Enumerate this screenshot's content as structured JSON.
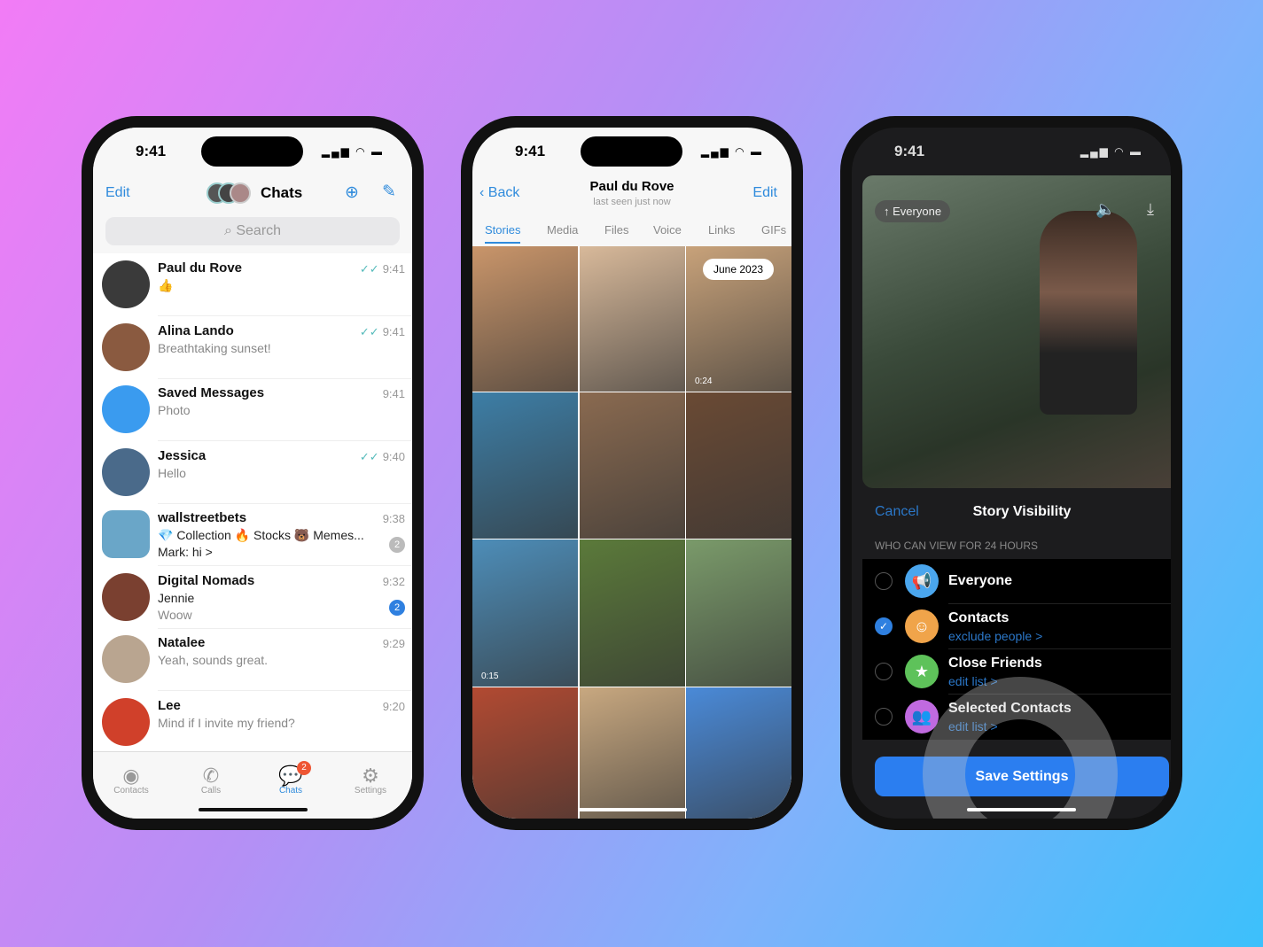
{
  "status_time": "9:41",
  "chats_screen": {
    "edit": "Edit",
    "title": "Chats",
    "search_placeholder": "Search",
    "chats": [
      {
        "name": "Paul du Rove",
        "preview": "👍",
        "time": "9:41",
        "read": true,
        "avatar_color": "#3a3a3a"
      },
      {
        "name": "Alina Lando",
        "preview": "Breathtaking sunset!",
        "time": "9:41",
        "read": true,
        "avatar_color": "#8a5a40"
      },
      {
        "name": "Saved Messages",
        "preview": "Photo",
        "time": "9:41",
        "read": false,
        "avatar_color": "#3a9bef"
      },
      {
        "name": "Jessica",
        "preview": "Hello",
        "time": "9:40",
        "read": true,
        "avatar_color": "#4a6a8a"
      },
      {
        "name": "wallstreetbets",
        "preview": "💎 Collection 🔥 Stocks 🐻 Memes...",
        "preview2": "Mark: hi >",
        "time": "9:38",
        "badge": "2",
        "avatar_color": "#6aa6c8"
      },
      {
        "name": "Digital Nomads",
        "preview": "Jennie",
        "preview2": "Woow",
        "time": "9:32",
        "badge": "2",
        "avatar_color": "#7a4030"
      },
      {
        "name": "Natalee",
        "preview": "Yeah, sounds great.",
        "time": "9:29",
        "avatar_color": "#b9a590"
      },
      {
        "name": "Lee",
        "preview": "Mind if I invite my friend?",
        "time": "9:20",
        "avatar_color": "#d0402a"
      }
    ],
    "tabs": [
      {
        "label": "Contacts",
        "icon": "person-circle"
      },
      {
        "label": "Calls",
        "icon": "phone"
      },
      {
        "label": "Chats",
        "icon": "chat-bubbles",
        "badge": "2",
        "active": true
      },
      {
        "label": "Settings",
        "icon": "gear"
      }
    ]
  },
  "profile_screen": {
    "back": "Back",
    "name": "Paul du Rove",
    "status": "last seen just now",
    "edit": "Edit",
    "tabs": [
      "Stories",
      "Media",
      "Files",
      "Voice",
      "Links",
      "GIFs"
    ],
    "active_tab": "Stories",
    "date_pill": "June 2023",
    "grid": [
      {
        "color": "#c9956a",
        "label": ""
      },
      {
        "color": "#d8b99a",
        "label": ""
      },
      {
        "color": "#c8a27a",
        "label": "0:24"
      },
      {
        "color": "#3d7ea6",
        "label": ""
      },
      {
        "color": "#8a6a50",
        "label": ""
      },
      {
        "color": "#6a4a34",
        "label": ""
      },
      {
        "color": "#4d8db8",
        "label": "0:15"
      },
      {
        "color": "#5b7a3a",
        "label": ""
      },
      {
        "color": "#7a9a6a",
        "label": ""
      },
      {
        "color": "#b24a32",
        "label": ""
      },
      {
        "color": "#c8a880",
        "label": ""
      },
      {
        "color": "#4a8ad8",
        "label": ""
      }
    ]
  },
  "story_screen": {
    "audience_pill": "Everyone",
    "cancel": "Cancel",
    "title": "Story Visibility",
    "section_header": "WHO CAN VIEW FOR 24 HOURS",
    "options": [
      {
        "label": "Everyone",
        "sub": "",
        "color": "#4aa6ee",
        "icon": "megaphone",
        "selected": false
      },
      {
        "label": "Contacts",
        "sub": "exclude people >",
        "color": "#f0a44a",
        "icon": "person",
        "selected": true
      },
      {
        "label": "Close Friends",
        "sub": "edit list >",
        "color": "#5ec25a",
        "icon": "star",
        "selected": false
      },
      {
        "label": "Selected Contacts",
        "sub": "edit list >",
        "color": "#c06ae0",
        "icon": "people",
        "selected": false
      }
    ],
    "save": "Save Settings"
  }
}
